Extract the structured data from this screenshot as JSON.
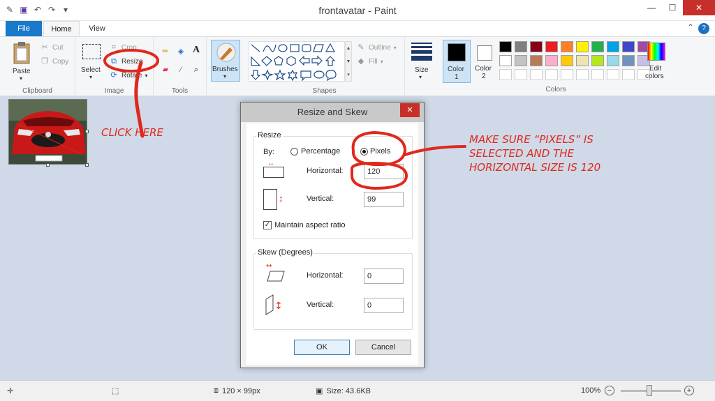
{
  "window": {
    "title": "frontavatar - Paint",
    "minimize": "—",
    "maximize": "☐",
    "close": "✕"
  },
  "tabs": {
    "file": "File",
    "home": "Home",
    "view": "View"
  },
  "ribbon": {
    "clipboard": {
      "label": "Clipboard",
      "paste": "Paste",
      "cut": "Cut",
      "copy": "Copy"
    },
    "image": {
      "label": "Image",
      "select": "Select",
      "crop": "Crop",
      "resize": "Resize",
      "rotate": "Rotate"
    },
    "tools": {
      "label": "Tools"
    },
    "brushes": {
      "label": "Brushes"
    },
    "shapes": {
      "label": "Shapes",
      "outline": "Outline",
      "fill": "Fill"
    },
    "size": {
      "label": "Size"
    },
    "color1": {
      "label": "Color",
      "num": "1"
    },
    "color2": {
      "label": "Color",
      "num": "2"
    },
    "colors": {
      "label": "Colors",
      "edit_label": "Edit",
      "edit_label2": "colors",
      "palette": [
        "#000000",
        "#7f7f7f",
        "#880015",
        "#ed1c24",
        "#ff7f27",
        "#fff200",
        "#22b14c",
        "#00a2e8",
        "#3f48cc",
        "#a349a4",
        "#ffffff",
        "#c3c3c3",
        "#b97a57",
        "#ffaec9",
        "#ffc90e",
        "#efe4b0",
        "#b5e61d",
        "#99d9ea",
        "#7092be",
        "#c8bfe7",
        "#ffffff",
        "#ffffff",
        "#ffffff",
        "#ffffff",
        "#ffffff",
        "#ffffff",
        "#ffffff",
        "#ffffff",
        "#ffffff",
        "#ffffff"
      ]
    }
  },
  "dialog": {
    "title": "Resize and Skew",
    "resize_legend": "Resize",
    "by": "By:",
    "percentage": "Percentage",
    "pixels": "Pixels",
    "horizontal_label": "Horizontal:",
    "horizontal_value": "120",
    "vertical_label": "Vertical:",
    "vertical_value": "99",
    "maintain": "Maintain aspect ratio",
    "skew_legend": "Skew (Degrees)",
    "skew_h_label": "Horizontal:",
    "skew_h_value": "0",
    "skew_v_label": "Vertical:",
    "skew_v_value": "0",
    "ok": "OK",
    "cancel": "Cancel"
  },
  "annotations": {
    "click_here": "CLICK HERE",
    "line1": "MAKE SURE “PIXELS” IS",
    "line2": "SELECTED AND THE",
    "line3": "HORIZONTAL SIZE IS 120"
  },
  "status": {
    "dimensions": "120 × 99px",
    "size": "Size: 43.6KB",
    "zoom": "100%"
  },
  "accent": "#1979ca",
  "annotation_color": "#e0281c"
}
